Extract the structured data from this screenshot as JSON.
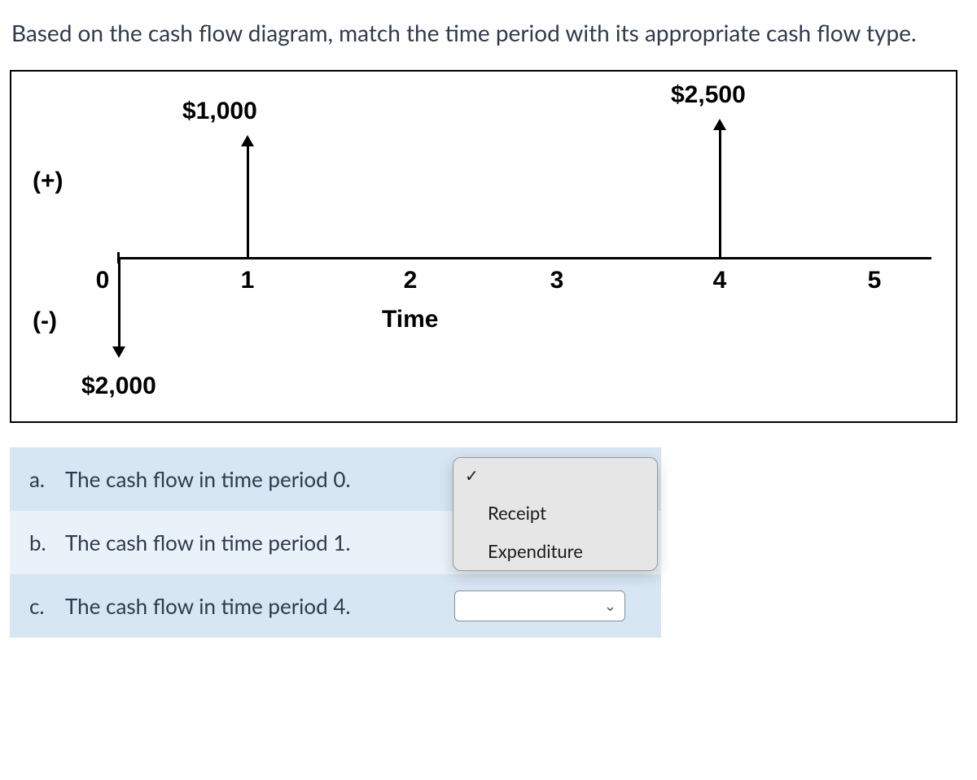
{
  "question_text": "Based on the cash flow diagram, match the time period with its appropriate cash flow type.",
  "diagram": {
    "plus_sign": "(+)",
    "minus_sign": "(-)",
    "time_label": "Time",
    "ticks": [
      "0",
      "1",
      "2",
      "3",
      "4",
      "5"
    ],
    "flow_t0": "$2,000",
    "flow_t1": "$1,000",
    "flow_t4": "$2,500"
  },
  "chart_data": {
    "type": "bar",
    "title": "Cash Flow Diagram",
    "xlabel": "Time",
    "ylabel": "",
    "categories": [
      0,
      1,
      2,
      3,
      4,
      5
    ],
    "values": [
      -2000,
      1000,
      0,
      0,
      2500,
      0
    ],
    "positive_label": "(+)",
    "negative_label": "(-)"
  },
  "matches": {
    "a": {
      "letter": "a.",
      "text": "The cash flow in time period 0."
    },
    "b": {
      "letter": "b.",
      "text": "The cash flow in time period 1."
    },
    "c": {
      "letter": "c.",
      "text": "The cash flow in time period 4."
    }
  },
  "dropdown": {
    "check": "✓",
    "option_blank": "",
    "option_receipt": "Receipt",
    "option_expenditure": "Expenditure"
  }
}
